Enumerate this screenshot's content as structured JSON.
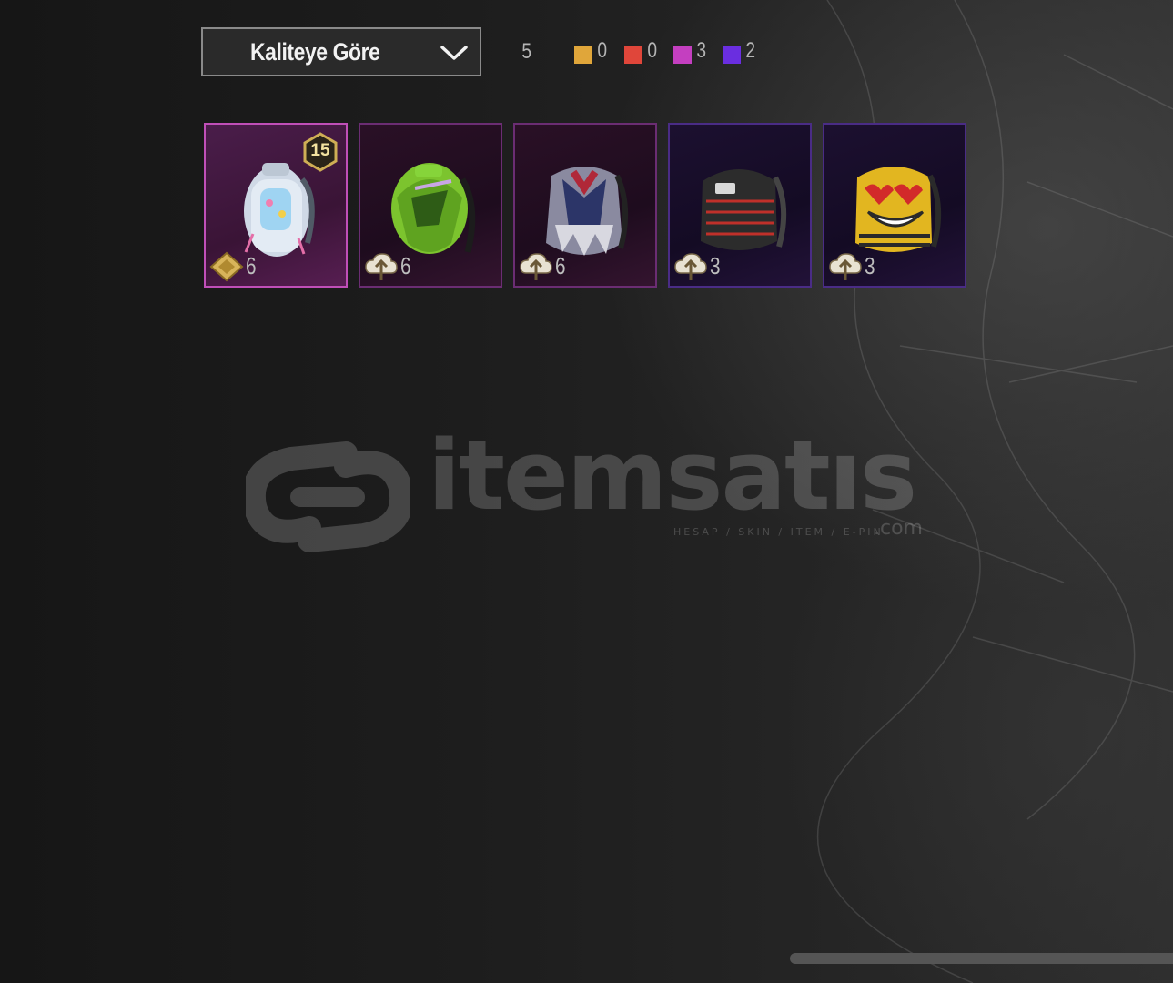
{
  "sort": {
    "label": "Kaliteye Göre"
  },
  "counts": {
    "total": "5",
    "quality": [
      {
        "color": "#e0a63a",
        "value": "0"
      },
      {
        "color": "#e0463a",
        "value": "0"
      },
      {
        "color": "#c43fc0",
        "value": "3"
      },
      {
        "color": "#6a2ee0",
        "value": "2"
      }
    ]
  },
  "items": [
    {
      "count": "6",
      "level": "15",
      "rarity": "legendary",
      "icon": "diamond-coupon-icon"
    },
    {
      "count": "6",
      "rarity": "epic",
      "icon": "upgrade-cloud-icon"
    },
    {
      "count": "6",
      "rarity": "epic",
      "icon": "upgrade-cloud-icon"
    },
    {
      "count": "3",
      "rarity": "rare",
      "icon": "upgrade-cloud-icon"
    },
    {
      "count": "3",
      "rarity": "rare",
      "icon": "upgrade-cloud-icon"
    }
  ],
  "watermark": {
    "brand": "itemsatıs",
    "tagline": "HESAP / SKIN / ITEM / E-PIN",
    "domain": ".com"
  }
}
